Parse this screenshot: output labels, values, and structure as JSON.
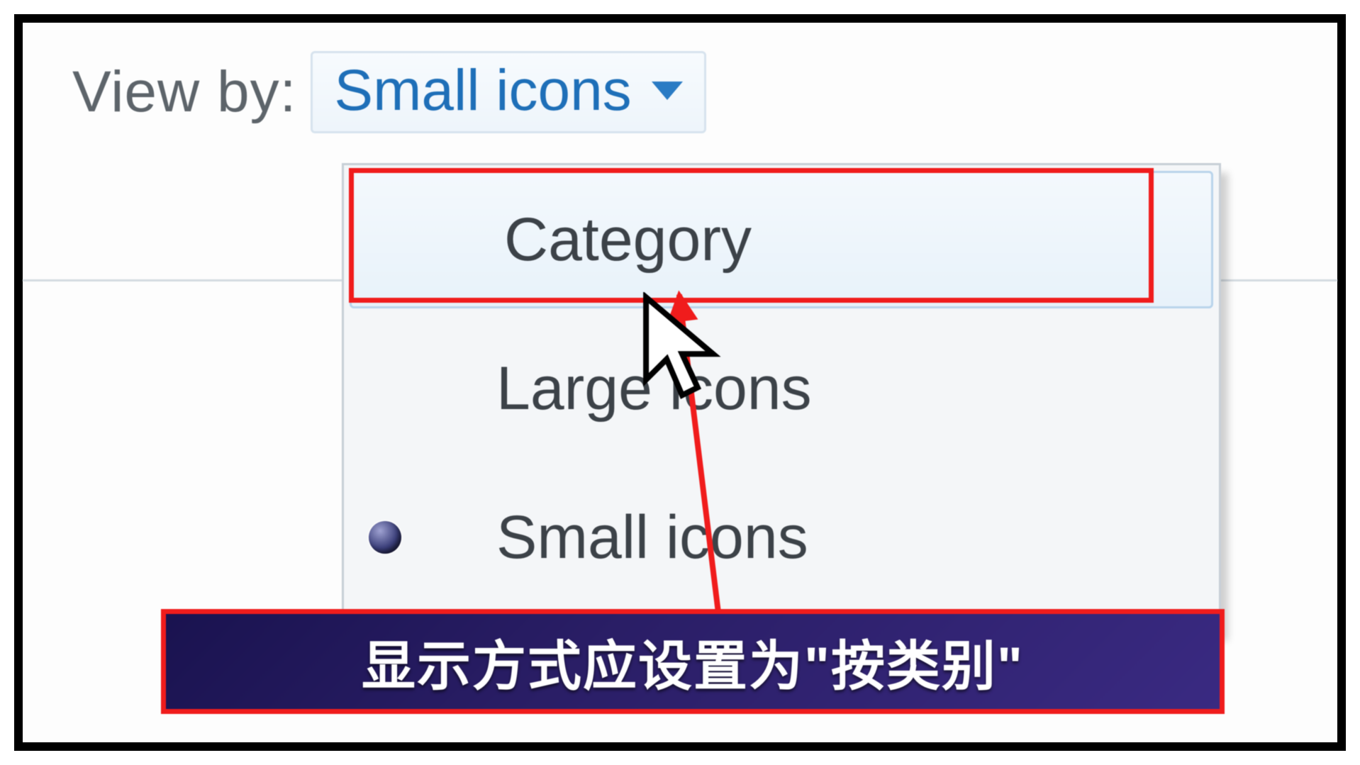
{
  "viewby": {
    "label": "View by:",
    "current": "Small icons"
  },
  "menu": {
    "items": [
      {
        "label": "Category",
        "selected": false,
        "hover": true
      },
      {
        "label": "Large icons",
        "selected": false,
        "hover": false
      },
      {
        "label": "Small icons",
        "selected": true,
        "hover": false
      }
    ]
  },
  "annotation": {
    "caption": "显示方式应设置为\"按类别\""
  }
}
